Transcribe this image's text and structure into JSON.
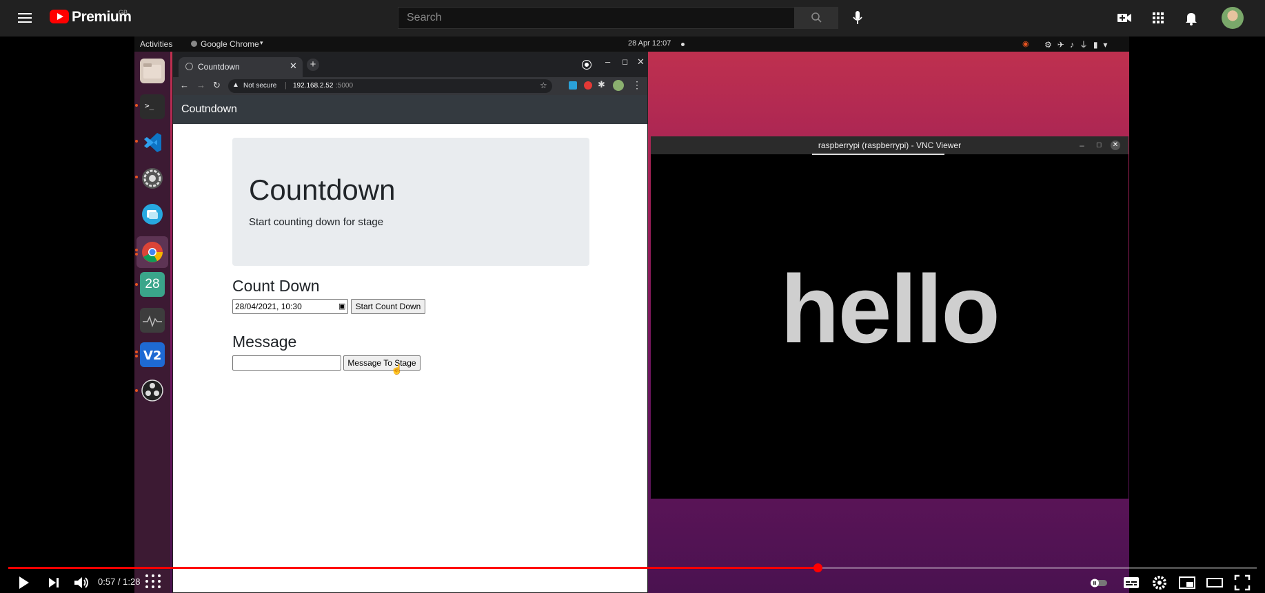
{
  "youtube": {
    "brand": "Premium",
    "region": "GB",
    "search_placeholder": "Search"
  },
  "gnome": {
    "activities": "Activities",
    "app_menu": "Google Chrome",
    "clock": "28 Apr  12:07"
  },
  "dock": {
    "apps": [
      "files-icon",
      "terminal-icon",
      "vscode-icon",
      "settings-icon",
      "photos-icon",
      "chrome-icon",
      "calendar-icon",
      "system-monitor-icon",
      "vnc-icon",
      "obs-icon"
    ],
    "calendar_day": "28"
  },
  "chrome": {
    "tab_title": "Countdown",
    "security": "Not secure",
    "url_host": "192.168.2.52",
    "url_port": ":5000"
  },
  "page": {
    "navbar_brand": "Coutndown",
    "jumbo_title": "Countdown",
    "jumbo_sub": "Start counting down for stage",
    "countdown_heading": "Count Down",
    "datetime_value": "28/04/2021, 10:30",
    "start_button": "Start Count Down",
    "message_heading": "Message",
    "message_value": "",
    "message_button": "Message To Stage"
  },
  "vnc": {
    "title": "raspberrypi (raspberrypi) - VNC Viewer",
    "display_text": "hello"
  },
  "player": {
    "current_time": "0:57",
    "duration": "1:28",
    "time_display": "0:57 / 1:28",
    "progress_fraction": 0.648
  },
  "colors": {
    "youtube_red": "#ff0000",
    "ubuntu_orange": "#e95420",
    "navbar": "#343a40"
  }
}
